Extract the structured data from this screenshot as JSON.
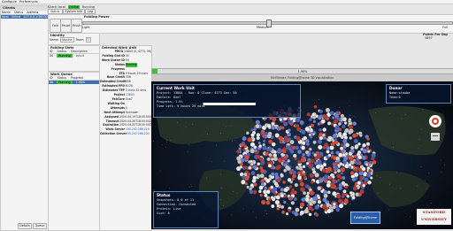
{
  "menu": {
    "items": [
      "Configure",
      "Preferences"
    ]
  },
  "clients": {
    "title": "Clients",
    "columns": [
      "Name",
      "Status",
      "Address"
    ],
    "selected_row": {
      "name": "local",
      "status": "Online",
      "address": "127.0.0.1:36330"
    },
    "footer_buttons": [
      "Add",
      "Edit",
      "Remove"
    ],
    "bottom_buttons": [
      "Details",
      "Queue"
    ]
  },
  "client_bar": {
    "label": "Client: local",
    "status": "Online",
    "state": "Running"
  },
  "tabs": [
    "Status",
    "System Info",
    "Log"
  ],
  "folding_power": {
    "title": "Folding Power",
    "buttons": [
      "Fold",
      "Pause",
      "Finish"
    ],
    "slider_labels": [
      "Light",
      "Medium",
      "Full"
    ],
    "level": 0.5
  },
  "identity": {
    "title": "Identity",
    "name_label": "Name",
    "name_value": "stauba",
    "team_label": "Team",
    "team_value": "0"
  },
  "points_per_day": {
    "label": "Points Per Day",
    "value": "5897"
  },
  "folding_slots": {
    "title": "Folding Slots",
    "columns": [
      "ID",
      "Status",
      "Description"
    ],
    "row": {
      "id": "00",
      "status": "Running",
      "desc": "cpu:4"
    }
  },
  "work_queue": {
    "title": "Work Queue",
    "columns": [
      "ID",
      "Status",
      "Progress"
    ],
    "row": {
      "id": "00",
      "status": "Running",
      "progress": "1.90%"
    }
  },
  "work_unit": {
    "title": "Selected Work Unit",
    "fields": [
      {
        "label": "PRCG",
        "value": "13804 (0, 4773, 56)"
      },
      {
        "label": "Folding Slot ID",
        "value": "00"
      },
      {
        "label": "Work Queue ID",
        "value": "00"
      },
      {
        "label": "Status",
        "value": "Running"
      },
      {
        "label": "Progress",
        "value": ""
      },
      {
        "label": "ETA",
        "value": "9 hours 29 mins"
      },
      {
        "label": "Base Credit",
        "value": "356"
      },
      {
        "label": "Estimated Credit",
        "value": "356"
      },
      {
        "label": "Estimated PPD",
        "value": "6176"
      },
      {
        "label": "Estimated TPF",
        "value": "5 mins 32 secs"
      },
      {
        "label": "Project",
        "value": "13804"
      },
      {
        "label": "FahCore",
        "value": "0xa7"
      },
      {
        "label": "Waiting On",
        "value": ""
      },
      {
        "label": "Attempts",
        "value": "0"
      },
      {
        "label": "Next Attempt",
        "value": "Unknown"
      },
      {
        "label": "Assigned",
        "value": "2020-04-19T18:00:00Z"
      },
      {
        "label": "Timeout",
        "value": "2020-04-20T18:00:00Z"
      },
      {
        "label": "Expiration",
        "value": "2020-04-22T18:00:00Z"
      },
      {
        "label": "Work Server",
        "value": "155.247.166.219"
      },
      {
        "label": "Collection Server",
        "value": "155.247.166.220"
      }
    ]
  },
  "progress_bar": {
    "text": "1.90%",
    "fraction": 0.019
  },
  "viewer": {
    "window_title": "FAHViewer: Folding@home 3D Visualization",
    "current_wu": {
      "title": "Current Work Unit",
      "lines": [
        "Project:   13804 - Run: 0 Clone: 4773 Gen: 56",
        "FahCore:   0xa7",
        "Progress:  1.9%",
        "Time Left: 9 hours 29 mins"
      ],
      "progress_fraction": 0.019
    },
    "donor": {
      "title": "Donor",
      "lines": [
        "Name:stauba",
        "Team:0"
      ]
    },
    "status": {
      "title": "Status",
      "lines": [
        "Snapshots: 0.0 of 11",
        "Connection: Connected",
        "Protein:   Live",
        "Size:      8"
      ]
    },
    "logo": "Folding@home",
    "university": "STANFORD UNIVERSITY"
  },
  "colors": {
    "accent": "#3dbf3d",
    "selection": "#3c6fb4",
    "hud_border": "#5a84b8"
  }
}
